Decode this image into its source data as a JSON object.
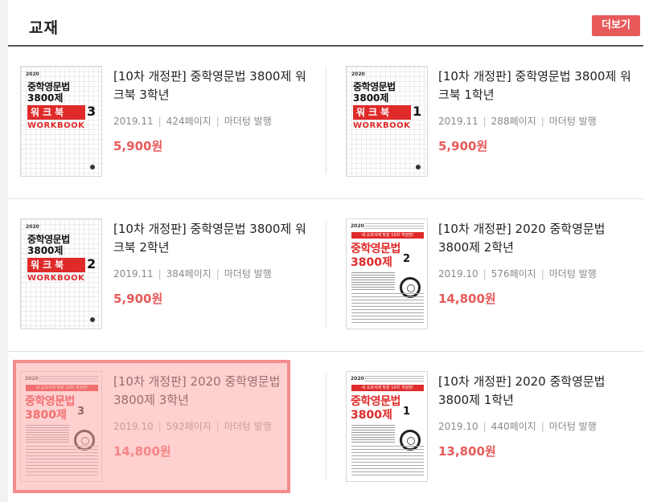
{
  "section": {
    "title": "교재",
    "more_label": "더보기"
  },
  "books": [
    {
      "title": "[10차 개정판] 중학영문법 3800제 워크북 3학년",
      "date": "2019.11",
      "pages": "424페이지",
      "publisher": "마더텅 발행",
      "price": "5,900원",
      "cover": {
        "style": "workbook",
        "year": "2020",
        "line1": "중학영문법",
        "line2": "3800제",
        "band": "워크북",
        "num": "3",
        "en": "WORKBOOK"
      }
    },
    {
      "title": "[10차 개정판] 중학영문법 3800제 워크북 1학년",
      "date": "2019.11",
      "pages": "288페이지",
      "publisher": "마더텅 발행",
      "price": "5,900원",
      "cover": {
        "style": "workbook",
        "year": "2020",
        "line1": "중학영문법",
        "line2": "3800제",
        "band": "워크북",
        "num": "1",
        "en": "WORKBOOK"
      }
    },
    {
      "title": "[10차 개정판] 중학영문법 3800제 워크북 2학년",
      "date": "2019.11",
      "pages": "384페이지",
      "publisher": "마더텅 발행",
      "price": "5,900원",
      "cover": {
        "style": "workbook",
        "year": "2020",
        "line1": "중학영문법",
        "line2": "3800제",
        "band": "워크북",
        "num": "2",
        "en": "WORKBOOK"
      }
    },
    {
      "title": "[10차 개정판] 2020 중학영문법 3800제 2학년",
      "date": "2019.10",
      "pages": "576페이지",
      "publisher": "마더텅 발행",
      "price": "14,800원",
      "cover": {
        "style": "main",
        "year": "2020",
        "banner": "새 교과서에 맞춘 10차 개정판!",
        "line1": "중학영문법",
        "line2": "3800제",
        "num": "2"
      }
    },
    {
      "title": "[10차 개정판] 2020 중학영문법 3800제 3학년",
      "date": "2019.10",
      "pages": "592페이지",
      "publisher": "마더텅 발행",
      "price": "14,800원",
      "cover": {
        "style": "main",
        "year": "2020",
        "banner": "새 교과서에 맞춘 10차 개정판!",
        "line1": "중학영문법",
        "line2": "3800제",
        "num": "3"
      }
    },
    {
      "title": "[10차 개정판] 2020 중학영문법 3800제 1학년",
      "date": "2019.10",
      "pages": "440페이지",
      "publisher": "마더텅 발행",
      "price": "13,800원",
      "cover": {
        "style": "main",
        "year": "2020",
        "banner": "새 교과서에 맞춘 10차 개정판!",
        "line1": "중학영문법",
        "line2": "3800제",
        "num": "1"
      }
    }
  ],
  "colors": {
    "accent": "#e85a5a",
    "cover_red": "#e02a2a",
    "highlight": "#f38c8c"
  }
}
